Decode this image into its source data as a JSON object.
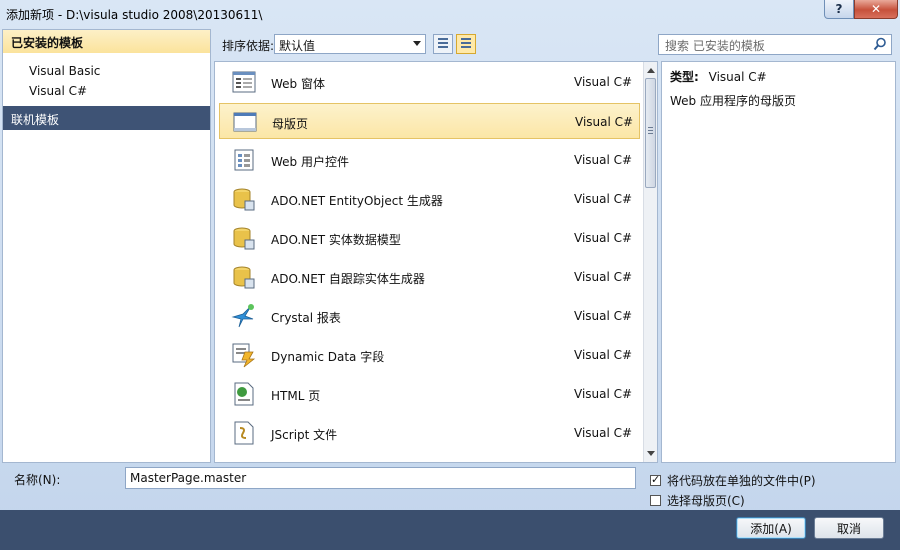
{
  "window": {
    "title": "添加新项 - D:\\visula studio 2008\\20130611\\",
    "help_label": "?",
    "close_label": "✕"
  },
  "left_panel": {
    "header": "已安装的模板",
    "items": [
      "Visual Basic",
      "Visual C#"
    ],
    "online": "联机模板"
  },
  "toolbar": {
    "sort_label": "排序依据:",
    "sort_value": "默认值",
    "search_placeholder": "搜索 已安装的模板"
  },
  "templates": [
    {
      "name": "Web 窗体",
      "lang": "Visual C#",
      "icon": "web-form-icon"
    },
    {
      "name": "母版页",
      "lang": "Visual C#",
      "icon": "master-page-icon",
      "selected": true
    },
    {
      "name": "Web 用户控件",
      "lang": "Visual C#",
      "icon": "user-control-icon"
    },
    {
      "name": "ADO.NET EntityObject 生成器",
      "lang": "Visual C#",
      "icon": "database-icon"
    },
    {
      "name": "ADO.NET 实体数据模型",
      "lang": "Visual C#",
      "icon": "database-icon"
    },
    {
      "name": "ADO.NET 自跟踪实体生成器",
      "lang": "Visual C#",
      "icon": "database-icon"
    },
    {
      "name": "Crystal 报表",
      "lang": "Visual C#",
      "icon": "crystal-report-icon"
    },
    {
      "name": "Dynamic Data 字段",
      "lang": "Visual C#",
      "icon": "dynamic-data-icon"
    },
    {
      "name": "HTML 页",
      "lang": "Visual C#",
      "icon": "html-page-icon"
    },
    {
      "name": "JScript 文件",
      "lang": "Visual C#",
      "icon": "jscript-file-icon"
    }
  ],
  "detail": {
    "type_label": "类型:",
    "type_value": "Visual C#",
    "description": "Web 应用程序的母版页"
  },
  "bottom": {
    "name_label": "名称(N):",
    "name_value": "MasterPage.master",
    "check_separate_code": "将代码放在单独的文件中(P)",
    "check_select_master": "选择母版页(C)",
    "add_button": "添加(A)",
    "cancel_button": "取消"
  },
  "colors": {
    "selection": "#fbe6a6",
    "online_bg": "#3e5375",
    "bottom_strip": "#3b4f6e"
  }
}
